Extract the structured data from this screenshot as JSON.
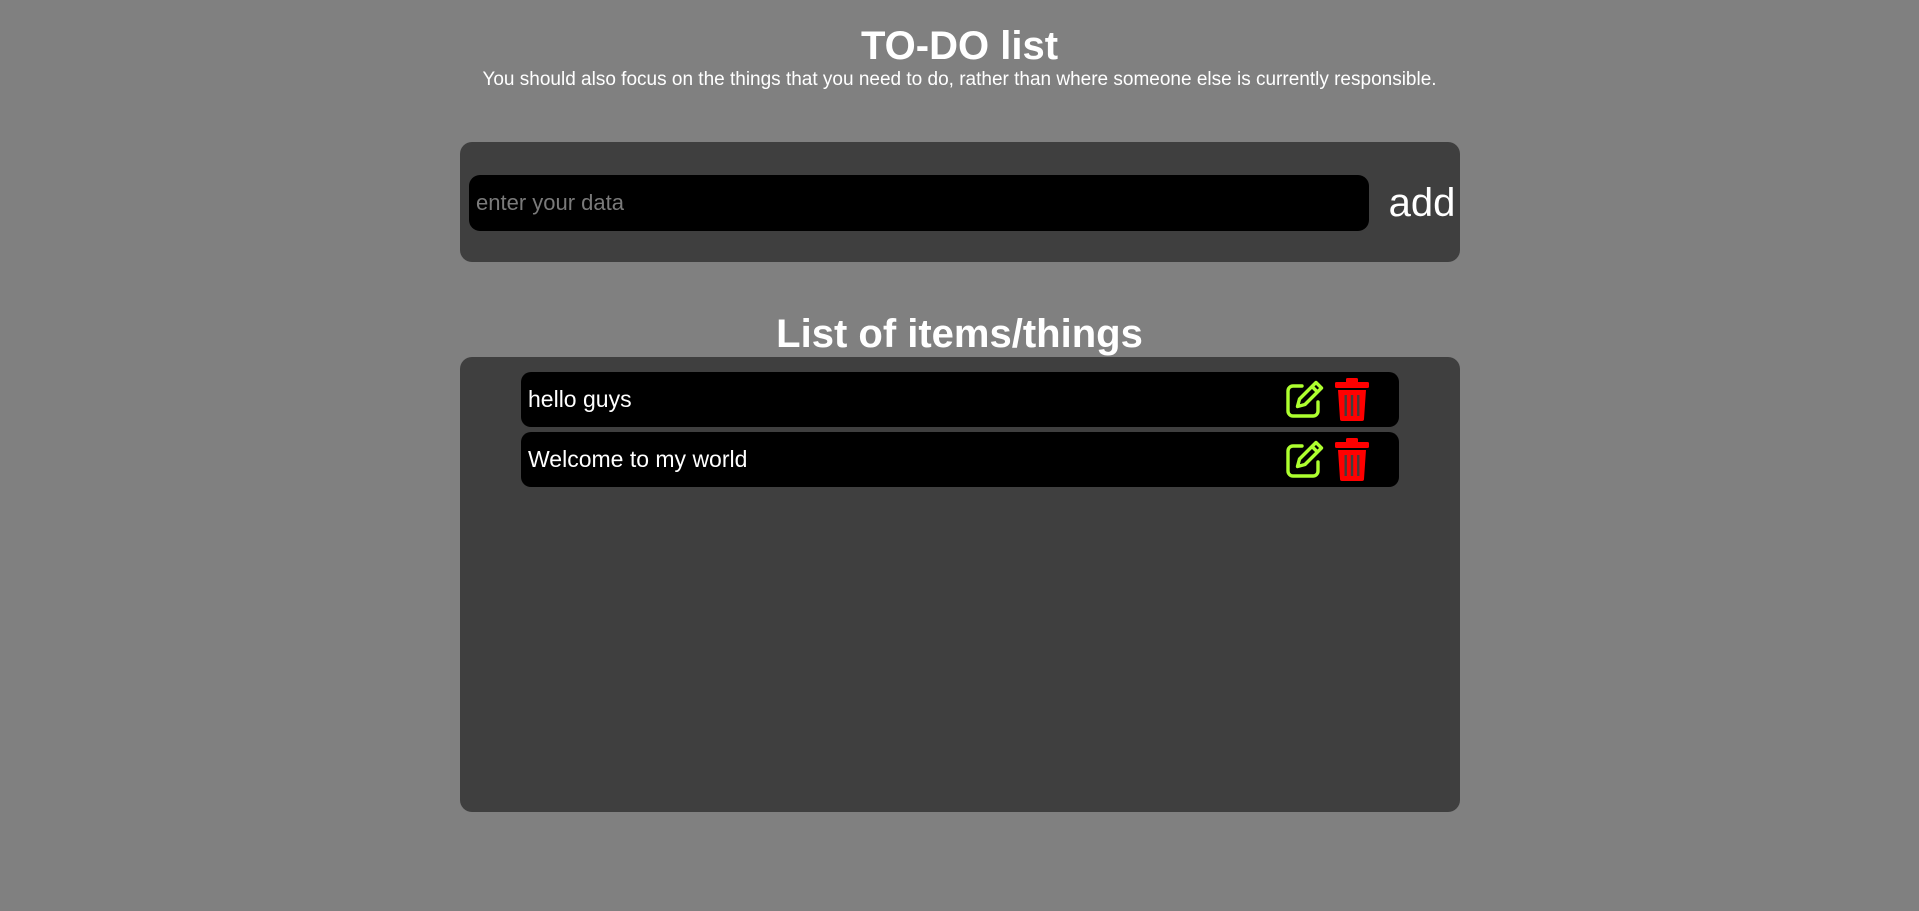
{
  "header": {
    "title": "TO-DO list",
    "subtitle": "You should also focus on the things that you need to do, rather than where someone else is currently responsible."
  },
  "entry": {
    "placeholder": "enter your data",
    "value": "",
    "add_label": "add"
  },
  "list": {
    "heading": "List of items/things",
    "items": [
      {
        "text": "hello guys",
        "edit_icon": "edit-icon",
        "delete_icon": "trash-icon"
      },
      {
        "text": "Welcome to my world",
        "edit_icon": "edit-icon",
        "delete_icon": "trash-icon"
      }
    ]
  },
  "colors": {
    "page_background": "#808080",
    "panel_background": "#3f3f3f",
    "item_background": "#000000",
    "edit_icon": "#adff2f",
    "delete_icon": "#ff0000",
    "text": "#ffffff"
  }
}
